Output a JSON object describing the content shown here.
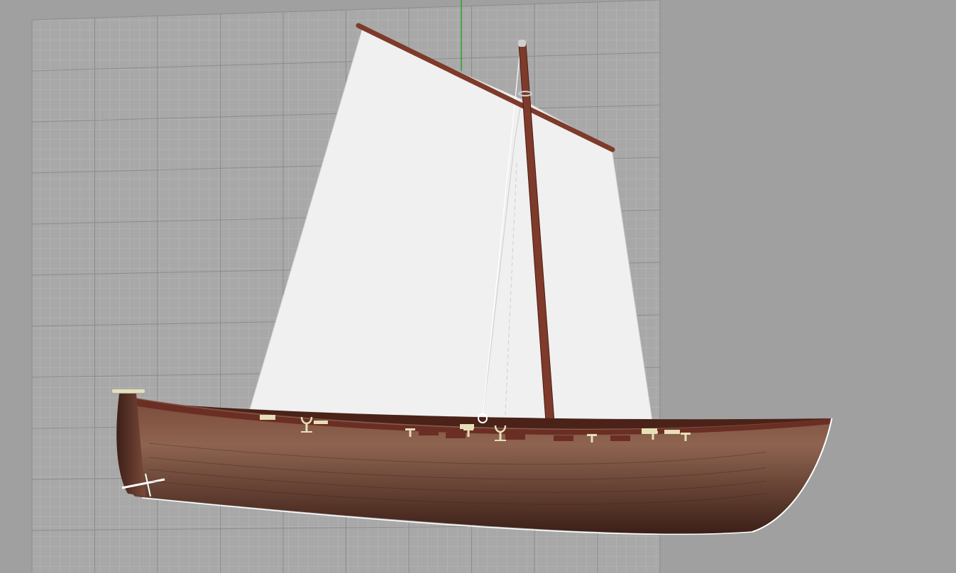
{
  "viewport": {
    "background": "#a0a0a0",
    "grid_plane": {
      "fill": "#a8a8a8",
      "minor_line": "#b9b9b9",
      "major_line": "#8c8c8c"
    },
    "axis": {
      "name": "z-axis",
      "color": "#2ea02e"
    }
  },
  "model": {
    "name": "sailing-boat",
    "colors": {
      "hull": "#7a4a3a",
      "hull_highlight": "#8e6450",
      "hull_shadow": "#3c1f17",
      "gunwale": "#6a2e25",
      "interior": "#4a2218",
      "spar": "#7e3a2a",
      "spar_edge": "#4c1e14",
      "sail": "#f0f0f0",
      "sail_edge": "#cfcfcf",
      "fitting": "#e6dfb8",
      "highlight_line": "#ffffff"
    },
    "parts": [
      "hull",
      "gunwale",
      "rudder",
      "mast",
      "yard",
      "lug-sail",
      "jib",
      "thwarts",
      "oarlocks",
      "cleats"
    ]
  }
}
